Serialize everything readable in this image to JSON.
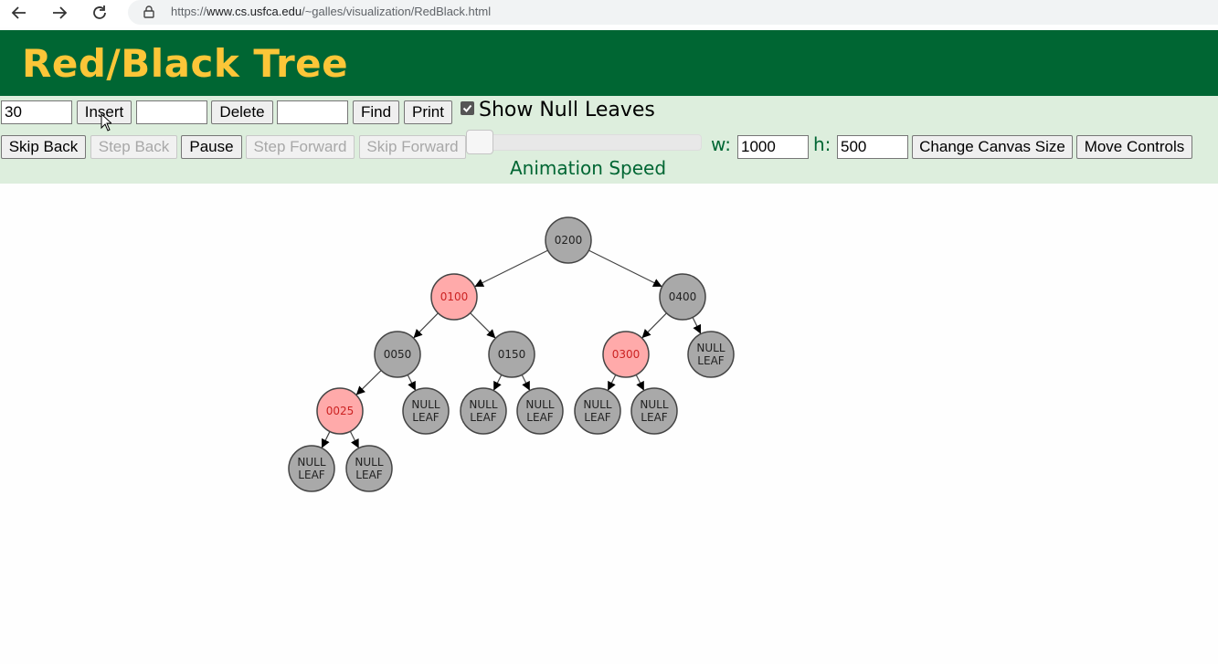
{
  "browser": {
    "url_prefix": "https://",
    "url_host": "www.cs.usfca.edu",
    "url_path": "/~galles/visualization/RedBlack.html"
  },
  "header": {
    "title": "Red/Black Tree"
  },
  "controls": {
    "insert_value": "30",
    "insert_label": "Insert",
    "delete_value": "",
    "delete_label": "Delete",
    "find_value": "",
    "find_label": "Find",
    "print_label": "Print",
    "show_null_leaves_label": "Show Null Leaves",
    "show_null_leaves_checked": true,
    "skip_back_label": "Skip Back",
    "step_back_label": "Step Back",
    "pause_label": "Pause",
    "step_forward_label": "Step Forward",
    "skip_forward_label": "Skip Forward",
    "animation_speed_label": "Animation Speed",
    "w_label": "w:",
    "w_value": "1000",
    "h_label": "h:",
    "h_value": "500",
    "change_canvas_label": "Change Canvas Size",
    "move_controls_label": "Move Controls"
  },
  "colors": {
    "header_bg": "#006633",
    "title": "#fcc638",
    "controls_bg": "#ddeedd",
    "black_node": "#a9a9a9",
    "red_node": "#ffaaaa",
    "red_text": "#cc2222"
  },
  "tree": {
    "nodes": [
      {
        "id": "n200",
        "label": "0200",
        "color": "black"
      },
      {
        "id": "n100",
        "label": "0100",
        "color": "red"
      },
      {
        "id": "n400",
        "label": "0400",
        "color": "black"
      },
      {
        "id": "n050",
        "label": "0050",
        "color": "black"
      },
      {
        "id": "n150",
        "label": "0150",
        "color": "black"
      },
      {
        "id": "n300",
        "label": "0300",
        "color": "red"
      },
      {
        "id": "nl400r",
        "label": "NULL\nLEAF",
        "color": "black"
      },
      {
        "id": "n025",
        "label": "0025",
        "color": "red"
      },
      {
        "id": "nl050r",
        "label": "NULL\nLEAF",
        "color": "black"
      },
      {
        "id": "nl150l",
        "label": "NULL\nLEAF",
        "color": "black"
      },
      {
        "id": "nl150r",
        "label": "NULL\nLEAF",
        "color": "black"
      },
      {
        "id": "nl300l",
        "label": "NULL\nLEAF",
        "color": "black"
      },
      {
        "id": "nl300r",
        "label": "NULL\nLEAF",
        "color": "black"
      },
      {
        "id": "nl025l",
        "label": "NULL\nLEAF",
        "color": "black"
      },
      {
        "id": "nl025r",
        "label": "NULL\nLEAF",
        "color": "black"
      }
    ],
    "edges": [
      [
        "n200",
        "n100"
      ],
      [
        "n200",
        "n400"
      ],
      [
        "n100",
        "n050"
      ],
      [
        "n100",
        "n150"
      ],
      [
        "n400",
        "n300"
      ],
      [
        "n400",
        "nl400r"
      ],
      [
        "n050",
        "n025"
      ],
      [
        "n050",
        "nl050r"
      ],
      [
        "n150",
        "nl150l"
      ],
      [
        "n150",
        "nl150r"
      ],
      [
        "n300",
        "nl300l"
      ],
      [
        "n300",
        "nl300r"
      ],
      [
        "n025",
        "nl025l"
      ],
      [
        "n025",
        "nl025r"
      ]
    ]
  }
}
